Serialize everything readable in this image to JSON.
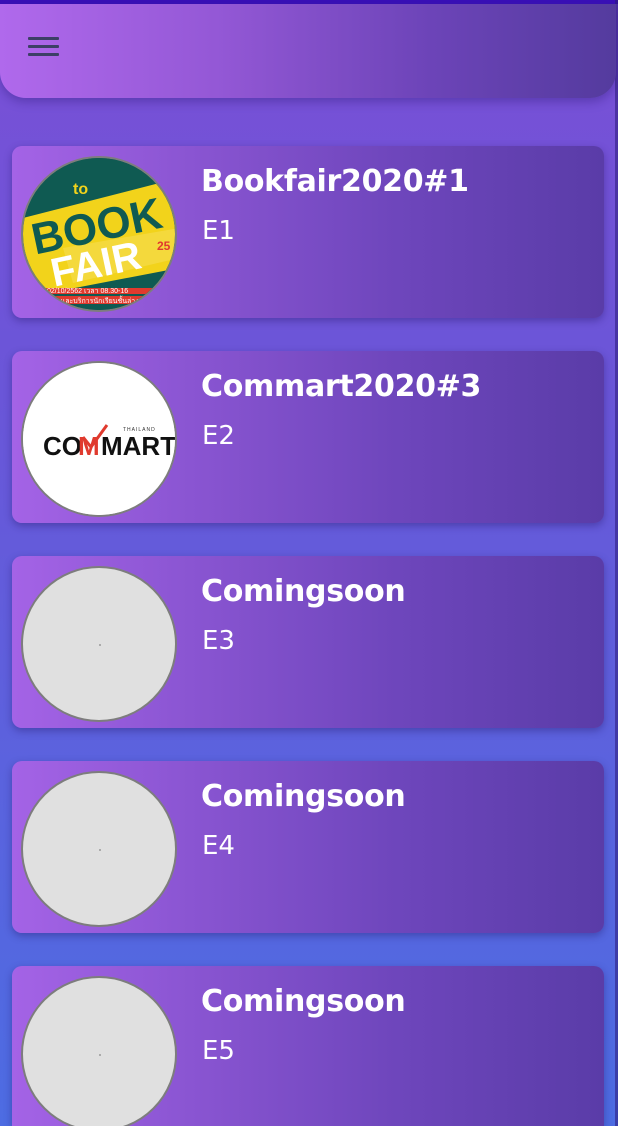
{
  "appbar": {
    "menu_icon": "hamburger-menu-icon"
  },
  "events": [
    {
      "title": "Bookfair2020#1",
      "code": "E1",
      "image": "bookfair-logo"
    },
    {
      "title": "Commart2020#3",
      "code": "E2",
      "image": "commart-logo"
    },
    {
      "title": "Comingsoon",
      "code": "E3",
      "image": "placeholder"
    },
    {
      "title": "Comingsoon",
      "code": "E4",
      "image": "placeholder"
    },
    {
      "title": "Comingsoon",
      "code": "E5",
      "image": "placeholder"
    }
  ],
  "logos": {
    "bookfair": {
      "to": "to",
      "book": "BOOK",
      "fair": "FAIR",
      "num": "25",
      "date_line": "02/10/2562 เวลา 08.30-16",
      "org_line": "ร และบริการนักเรียนชั้นล่าง"
    },
    "commart": {
      "thailand": "THAILAND",
      "co": "CO",
      "m": "M",
      "mart": "MART"
    }
  },
  "colors": {
    "card_start": "#a463e6",
    "card_end": "#5a3ca8",
    "appbar_start": "#b069ec",
    "appbar_end": "#543b9e",
    "accent_red": "#e03a2e"
  }
}
